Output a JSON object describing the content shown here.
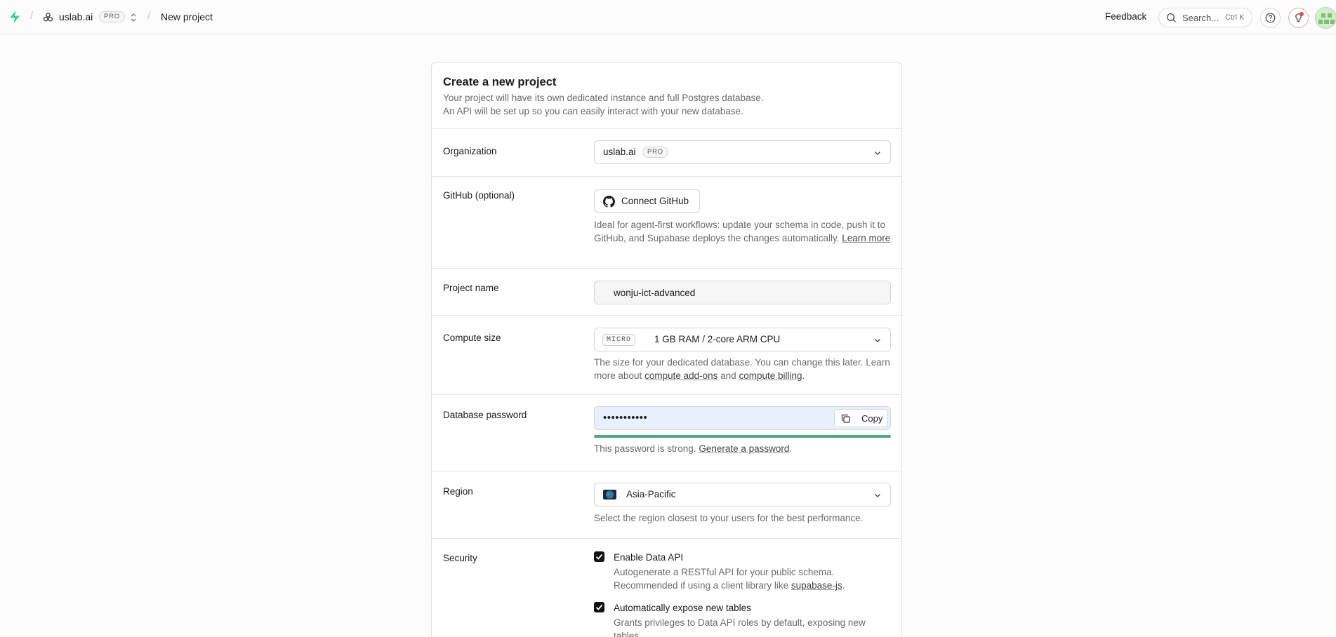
{
  "topbar": {
    "org_name": "uslab.ai",
    "org_badge": "PRO",
    "page_title": "New project",
    "feedback_label": "Feedback",
    "search_placeholder": "Search...",
    "search_shortcut": "Ctrl K"
  },
  "card": {
    "title": "Create a new project",
    "desc_line1": "Your project will have its own dedicated instance and full Postgres database.",
    "desc_line2": "An API will be set up so you can easily interact with your new database."
  },
  "organization": {
    "label": "Organization",
    "value": "uslab.ai",
    "badge": "PRO"
  },
  "github": {
    "label": "GitHub (optional)",
    "button_label": "Connect GitHub",
    "help_text": "Ideal for agent-first workflows: update your schema in code, push it to GitHub, and Supabase deploys the changes automatically.",
    "learn_more": "Learn more"
  },
  "project_name": {
    "label": "Project name",
    "value": "wonju-ict-advanced"
  },
  "compute": {
    "label": "Compute size",
    "badge": "MICRO",
    "value": "1 GB RAM / 2-core ARM CPU",
    "help_text": "The size for your dedicated database. You can change this later. Learn more about",
    "link1": "compute add-ons",
    "and": "and",
    "link2": "compute billing",
    "period": "."
  },
  "password": {
    "label": "Database password",
    "masked_value": "•••••••••••",
    "copy_label": "Copy",
    "strength_fraction": 1.0,
    "help_text": "This password is strong.",
    "generate_link": "Generate a password",
    "period": "."
  },
  "region": {
    "label": "Region",
    "value": "Asia-Pacific",
    "help_text": "Select the region closest to your users for the best performance."
  },
  "security": {
    "label": "Security",
    "option1_title": "Enable Data API",
    "option1_desc": "Autogenerate a RESTful API for your public schema. Recommended if using a client library like",
    "option1_link": "supabase-js",
    "option1_period": ".",
    "option1_checked": true,
    "option2_title": "Automatically expose new tables",
    "option2_desc": "Grants privileges to Data API roles by default, exposing new tables.",
    "option2_checked": true
  },
  "colors": {
    "brand": "#3ecf8e",
    "strength_bar": "#3c9a6a",
    "notification_dot": "#e5484d",
    "autofill_bg": "#e8f0fb"
  }
}
